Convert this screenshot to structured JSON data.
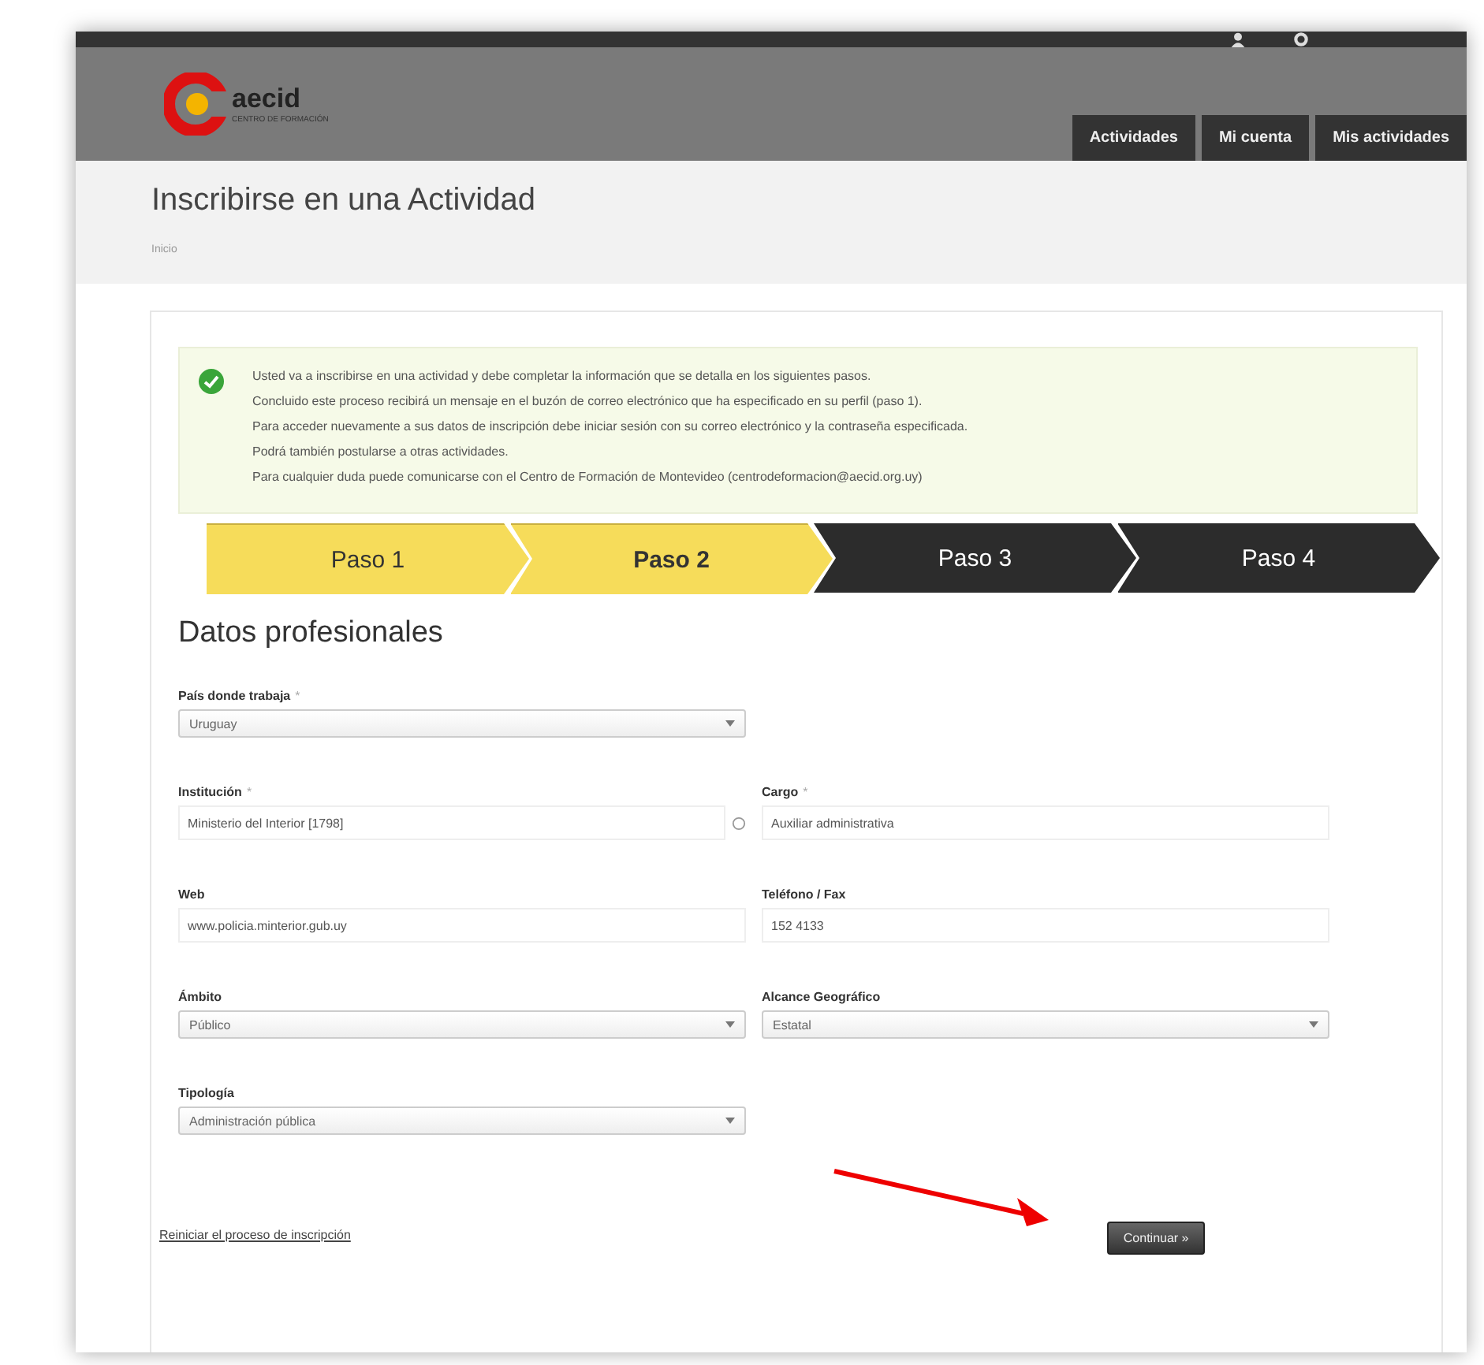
{
  "header": {
    "logo": {
      "name": "aecid",
      "subtitle": "CENTRO DE FORMACIÓN"
    },
    "nav": [
      {
        "label": "Actividades",
        "selected": false
      },
      {
        "label": "Mi cuenta",
        "selected": false
      },
      {
        "label": "Mis actividades",
        "selected": false
      }
    ]
  },
  "page": {
    "title": "Inscribirse en una Actividad",
    "breadcrumb": "Inicio"
  },
  "notice": {
    "lines": [
      "Usted va a inscribirse en una actividad y debe completar la información que se detalla en los siguientes pasos.",
      "Concluido este proceso recibirá un mensaje en el buzón de correo electrónico que ha especificado en su perfil (paso 1).",
      "Para acceder nuevamente a sus datos de inscripción debe iniciar sesión con su correo electrónico y la contraseña especificada.",
      "Podrá también postularse a otras actividades.",
      "Para cualquier duda puede comunicarse con el Centro de Formación de Montevideo (centrodeformacion@aecid.org.uy)"
    ]
  },
  "steps": [
    {
      "label": "Paso 1",
      "done": true,
      "selected": false
    },
    {
      "label": "Paso 2",
      "done": false,
      "selected": true
    },
    {
      "label": "Paso 3",
      "done": false,
      "selected": false
    },
    {
      "label": "Paso 4",
      "done": false,
      "selected": false
    }
  ],
  "section_title": "Datos profesionales",
  "form_rows": [
    [
      {
        "label": "País donde trabaja",
        "required_mark": "*",
        "kind": "select",
        "value": "Uruguay"
      }
    ],
    [
      {
        "label": "Institución",
        "required_mark": "*",
        "kind": "lookup",
        "value": "Ministerio del Interior [1798]"
      },
      {
        "label": "Cargo",
        "required_mark": "*",
        "kind": "text",
        "value": "Auxiliar administrativa"
      }
    ],
    [
      {
        "label": "Web",
        "kind": "text",
        "value": "www.policia.minterior.gub.uy"
      },
      {
        "label": "Teléfono / Fax",
        "kind": "text",
        "value": "152 4133"
      }
    ],
    [
      {
        "label": "Ámbito",
        "kind": "select",
        "value": "Público"
      },
      {
        "label": "Alcance Geográfico",
        "kind": "select",
        "value": "Estatal"
      }
    ],
    [
      {
        "label": "Tipología",
        "kind": "select",
        "value": "Administración pública"
      }
    ]
  ],
  "restart_link": "Reiniciar el proceso de inscripción",
  "continue_button": "Continuar »"
}
